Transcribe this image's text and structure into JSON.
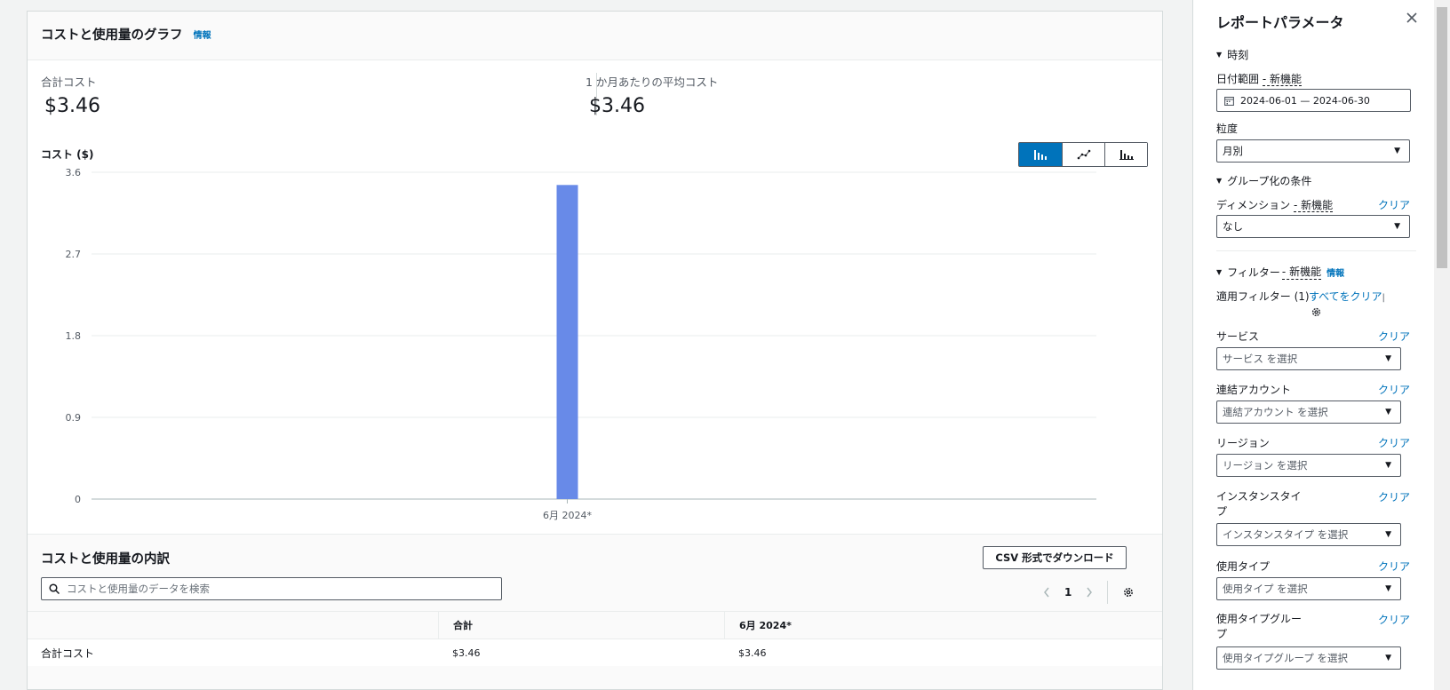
{
  "graph": {
    "title": "コストと使用量のグラフ",
    "info": "情報",
    "total_label": "合計コスト",
    "total_value": "$3.46",
    "avg_label": "1 か月あたりの平均コスト",
    "avg_value": "$3.46"
  },
  "chart_data": {
    "type": "bar",
    "ylabel": "コスト ($)",
    "categories": [
      "6月 2024*"
    ],
    "values": [
      3.46
    ],
    "yticks": [
      "0",
      "0.9",
      "1.8",
      "2.7",
      "3.6"
    ],
    "ylim": [
      0,
      3.6
    ],
    "bar_color": "#688ae8",
    "grid": true
  },
  "breakdown": {
    "title": "コストと使用量の内訳",
    "csv_button": "CSV 形式でダウンロード",
    "search_placeholder": "コストと使用量のデータを検索",
    "page": "1",
    "columns": [
      "",
      "合計",
      "6月 2024*"
    ],
    "rows": [
      [
        "合計コスト",
        "$3.46",
        "$3.46"
      ]
    ]
  },
  "params": {
    "title": "レポートパラメータ",
    "time_section": "時刻",
    "date_range_label": "日付範囲",
    "new_feature": "- 新機能",
    "date_range_value": "2024-06-01 — 2024-06-30",
    "granularity_label": "粒度",
    "granularity_value": "月別",
    "group_section": "グループ化の条件",
    "dimension_label": "ディメンション",
    "dimension_value": "なし",
    "clear": "クリア",
    "filter_section": "フィルター",
    "info": "情報",
    "applied_filters": "適用フィルター (1)",
    "clear_all": "すべてをクリア",
    "filters": [
      {
        "label": "サービス",
        "placeholder": "サービス を選択"
      },
      {
        "label": "連結アカウント",
        "placeholder": "連結アカウント を選択"
      },
      {
        "label": "リージョン",
        "placeholder": "リージョン を選択"
      },
      {
        "label1": "インスタンスタイ",
        "label2": "プ",
        "placeholder": "インスタンスタイプ を選択"
      },
      {
        "label": "使用タイプ",
        "placeholder": "使用タイプ を選択"
      },
      {
        "label1": "使用タイプグルー",
        "label2": "プ",
        "placeholder": "使用タイプグループ を選択"
      }
    ]
  }
}
